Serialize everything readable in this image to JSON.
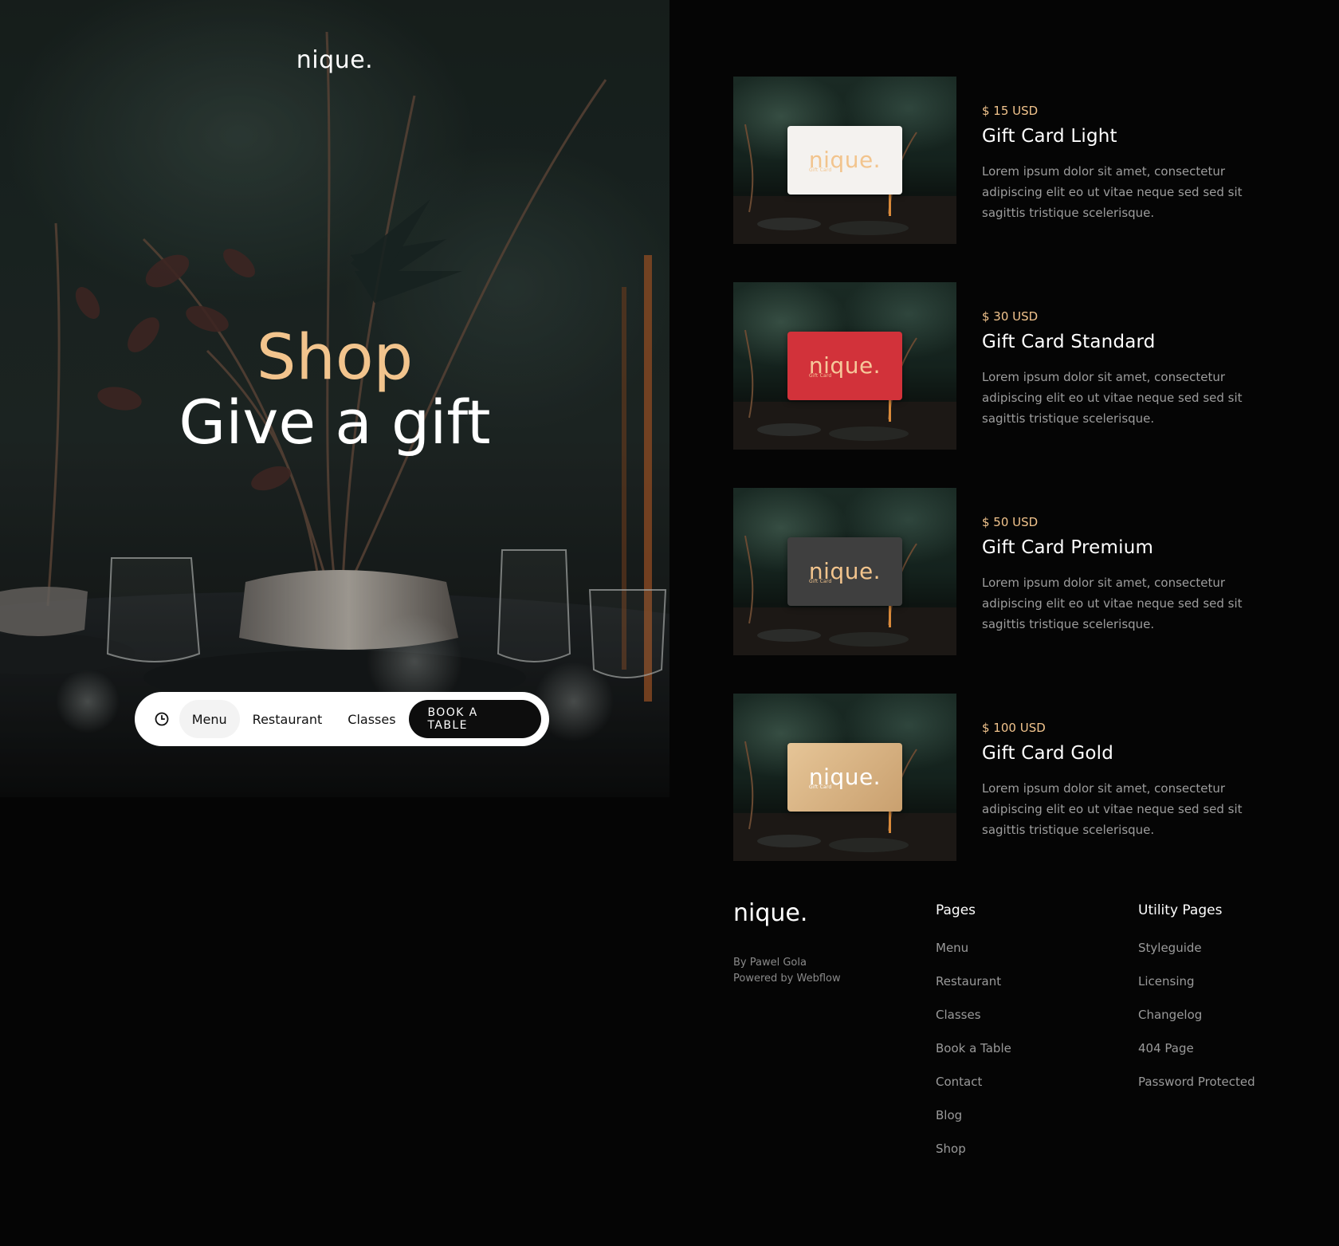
{
  "brand": {
    "logo": "nique."
  },
  "hero": {
    "title_line1": "Shop",
    "title_line2": "Give a gift"
  },
  "nav": {
    "icon": "clock-icon",
    "items": [
      "Menu",
      "Restaurant",
      "Classes"
    ],
    "cta": "BOOK A TABLE"
  },
  "products": [
    {
      "price": "$ 15 USD",
      "name": "Gift Card Light",
      "description": "Lorem ipsum dolor sit amet, consectetur adipiscing elit eo ut vitae neque sed sed sit sagittis tristique scelerisque.",
      "card_logo": "nique.",
      "card_sub": "Gift Card",
      "card_color": "#f4f2ef",
      "card_text_color": "#f2c48d"
    },
    {
      "price": "$ 30 USD",
      "name": "Gift Card Standard",
      "description": "Lorem ipsum dolor sit amet, consectetur adipiscing elit eo ut vitae neque sed sed sit sagittis tristique scelerisque.",
      "card_logo": "nique.",
      "card_sub": "Gift Card",
      "card_color": "#d2323a",
      "card_text_color": "#f6c89a"
    },
    {
      "price": "$ 50 USD",
      "name": "Gift Card Premium",
      "description": "Lorem ipsum dolor sit amet, consectetur adipiscing elit eo ut vitae neque sed sed sit sagittis tristique scelerisque.",
      "card_logo": "nique.",
      "card_sub": "Gift Card",
      "card_color": "#3f3f3f",
      "card_text_color": "#f2c48d"
    },
    {
      "price": "$ 100 USD",
      "name": "Gift Card Gold",
      "description": "Lorem ipsum dolor sit amet, consectetur adipiscing elit eo ut vitae neque sed sed sit sagittis tristique scelerisque.",
      "card_logo": "nique.",
      "card_sub": "Gift Card",
      "card_color": "#d9b385",
      "card_text_color": "#ffffff"
    }
  ],
  "footer": {
    "logo": "nique.",
    "credit_line1": "By Pawel Gola",
    "credit_line2": "Powered by Webflow",
    "pages_title": "Pages",
    "pages": [
      "Menu",
      "Restaurant",
      "Classes",
      "Book a Table",
      "Contact",
      "Blog",
      "Shop"
    ],
    "utility_title": "Utility Pages",
    "utility": [
      "Styleguide",
      "Licensing",
      "Changelog",
      "404 Page",
      "Password Protected"
    ]
  },
  "colors": {
    "accent": "#f2c48d",
    "background": "#050505"
  }
}
